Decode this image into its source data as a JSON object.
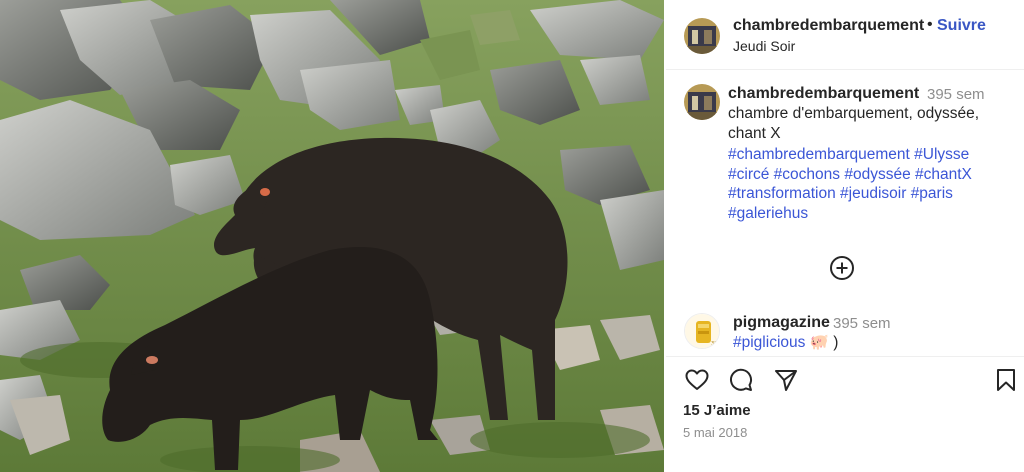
{
  "post": {
    "username": "chambredembarquement",
    "separator": "•",
    "follow_label": "Suivre",
    "location": "Jeudi Soir"
  },
  "caption": {
    "username": "chambredembarquement",
    "time": "395 sem",
    "text": "chambre d'embarquement, odyssée, chant X",
    "hashtags": [
      "#chambredembarquement",
      "#Ulysse",
      "#circé",
      "#cochons",
      "#odyssée",
      "#chantX",
      "#transformation",
      "#jeudisoir",
      "#paris",
      "#galeriehus"
    ]
  },
  "comment": {
    "username": "pigmagazine",
    "time": "395 sem",
    "hashtag": "#piglicious",
    "suffix": " 🐖 )"
  },
  "stats": {
    "likes": "15 J’aime",
    "date": "5 mai 2018"
  },
  "icons": {
    "more_comments": "plus-circle-icon",
    "like": "heart-icon",
    "comment": "speech-bubble-icon",
    "share": "paper-plane-icon",
    "save": "bookmark-icon"
  },
  "colors": {
    "link_blue": "#3b56d6",
    "follow_blue": "#3a57c4",
    "muted": "#8e8e8e",
    "text": "#262626"
  }
}
